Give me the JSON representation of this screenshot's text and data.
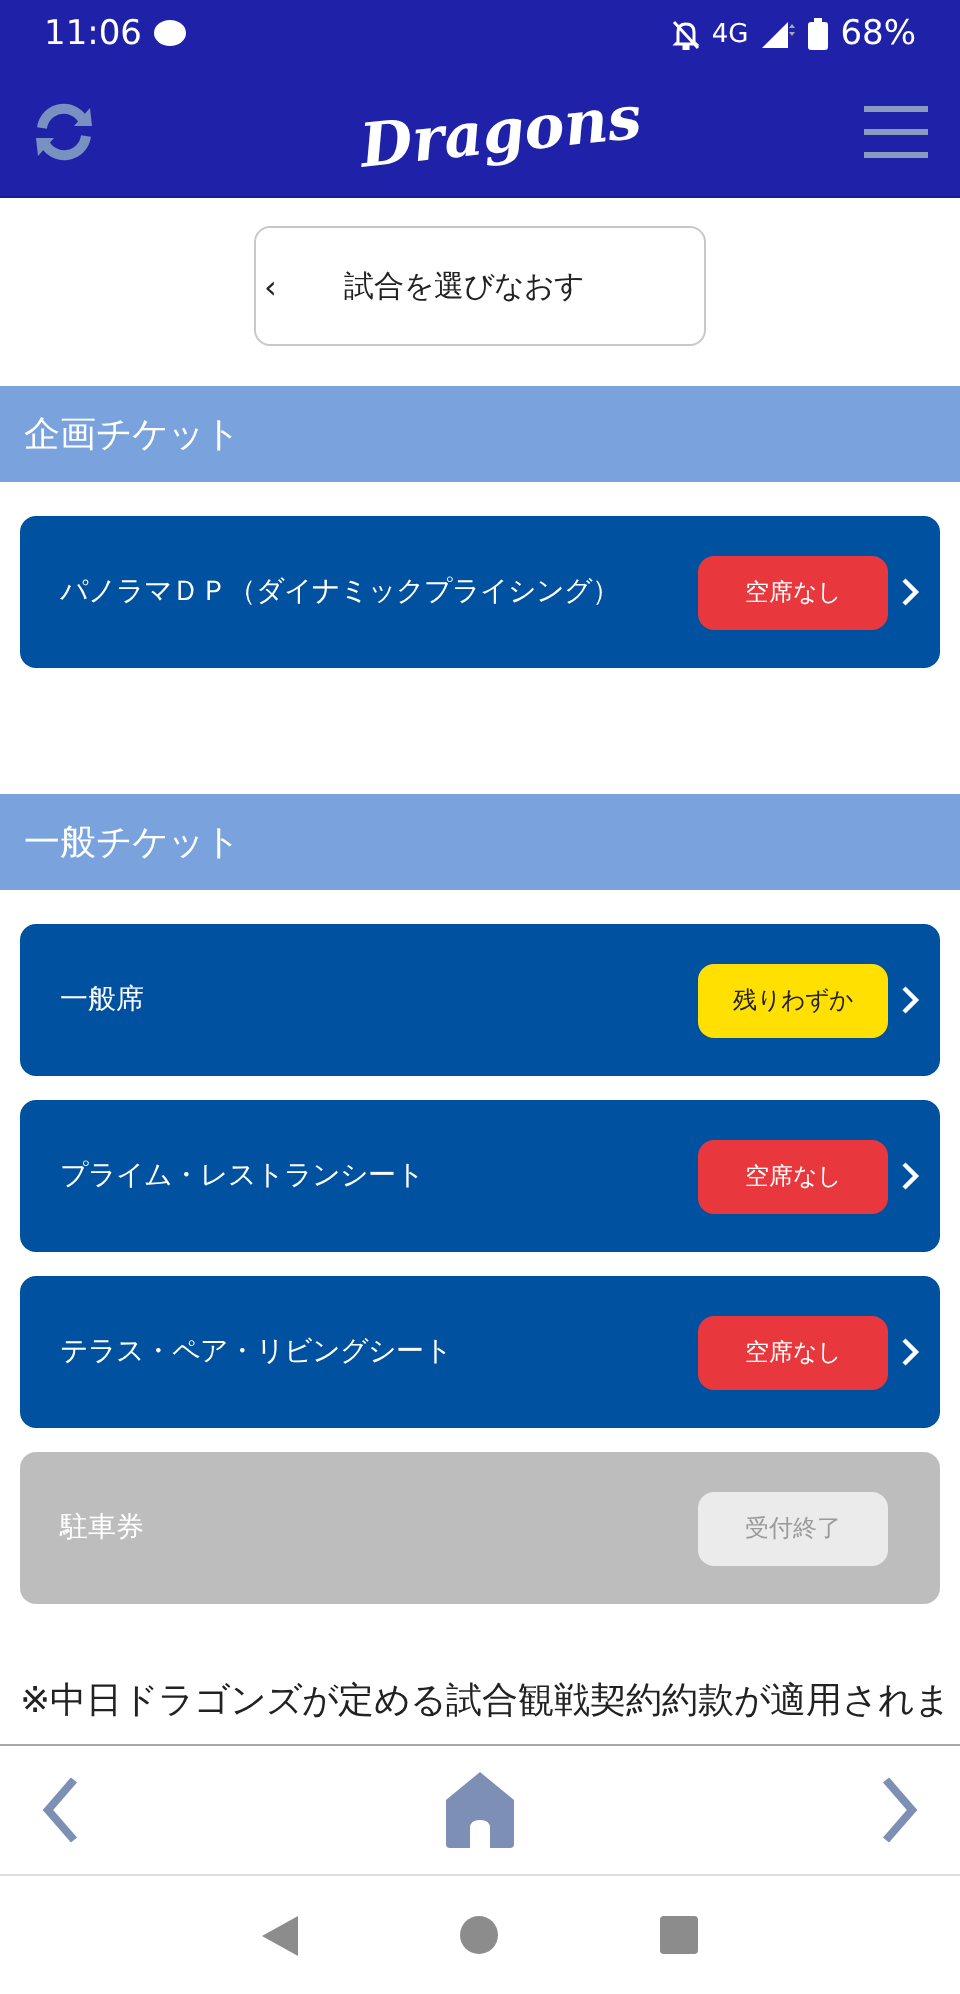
{
  "status_bar": {
    "time": "11:06",
    "network": "4G",
    "battery": "68%"
  },
  "header": {
    "logo": "Dragons"
  },
  "back_button": {
    "label": "試合を選びなおす",
    "arrow": "‹"
  },
  "sections": [
    {
      "title": "企画チケット",
      "items": [
        {
          "label": "パノラマＤＰ（ダイナミックプライシング）",
          "status": "空席なし",
          "kind": "soldout",
          "disabled": false
        }
      ]
    },
    {
      "title": "一般チケット",
      "items": [
        {
          "label": "一般席",
          "status": "残りわずか",
          "kind": "few",
          "disabled": false
        },
        {
          "label": "プライム・レストランシート",
          "status": "空席なし",
          "kind": "soldout",
          "disabled": false
        },
        {
          "label": "テラス・ペア・リビングシート",
          "status": "空席なし",
          "kind": "soldout",
          "disabled": false
        },
        {
          "label": "駐車券",
          "status": "受付終了",
          "kind": "closed",
          "disabled": true
        }
      ]
    }
  ],
  "notice": "※中日ドラゴンズが定める試合観戦契約約款が適用されま"
}
